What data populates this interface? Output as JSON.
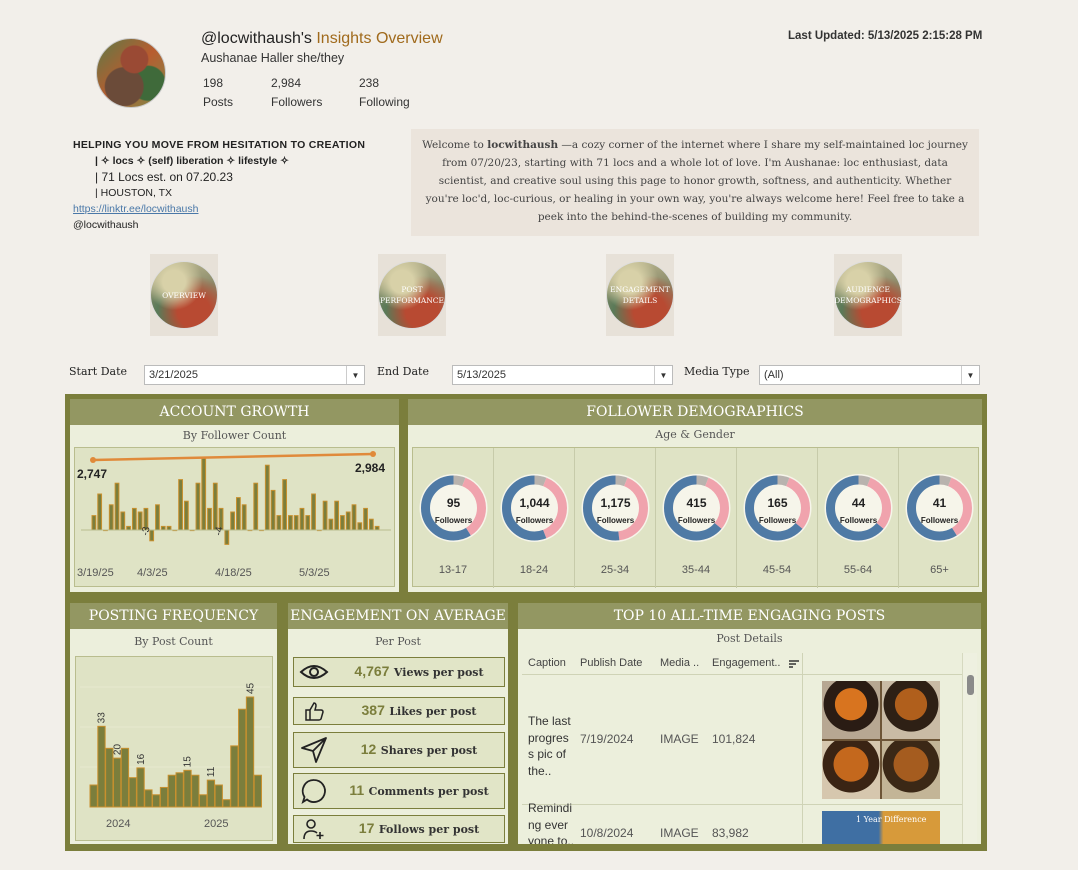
{
  "header": {
    "handle": "@locwithaush's",
    "title_accent": "Insights Overview",
    "name": "Aushanae Haller  she/they",
    "stats": [
      {
        "value": "198",
        "label": "Posts"
      },
      {
        "value": "2,984",
        "label": "Followers"
      },
      {
        "value": "238",
        "label": "Following"
      }
    ],
    "last_updated": "Last Updated: 5/13/2025 2:15:28 PM"
  },
  "bio": {
    "line1": "HELPING YOU MOVE FROM HESITATION TO CREATION",
    "line2": "| ✧ locs ✧ (self) liberation ✧ lifestyle ✧",
    "line3": "| 71 Locs est. on 07.20.23",
    "line4": "| HOUSTON, TX",
    "link": "https://linktr.ee/locwithaush",
    "line6": "@locwithaush"
  },
  "welcome": {
    "pre": "Welcome to ",
    "bold": "locwithaush",
    "text": " —a cozy corner of the internet where I share my self-maintained loc journey from 07/20/23, starting with 71 locs and a whole lot of love. I'm Aushanae: loc enthusiast, data scientist, and creative soul using this page to honor growth, softness, and authenticity. Whether you're loc'd, loc-curious, or healing in your own way, you're always welcome here! Feel free to take a peek into the behind-the-scenes of building my community."
  },
  "nav": [
    {
      "label": "OVERVIEW"
    },
    {
      "label": "POST PERFORMANCE"
    },
    {
      "label": "ENGAGEMENT DETAILS"
    },
    {
      "label": "AUDIENCE DEMOGRAPHICS"
    }
  ],
  "filters": {
    "start_label": "Start Date",
    "start_value": "3/21/2025",
    "end_label": "End Date",
    "end_value": "5/13/2025",
    "media_label": "Media Type",
    "media_value": "(All)"
  },
  "account_growth": {
    "title": "ACCOUNT GROWTH",
    "subtitle": "By Follower Count",
    "start_value": "2,747",
    "end_value": "2,984",
    "neg_labels": [
      "-3",
      "-4"
    ]
  },
  "follower_demographics": {
    "title": "FOLLOWER DEMOGRAPHICS",
    "subtitle": "Age & Gender",
    "unit": "Followers",
    "groups": [
      {
        "age": "13-17",
        "count": "95",
        "female_share": 0.35
      },
      {
        "age": "18-24",
        "count": "1,044",
        "female_share": 0.38
      },
      {
        "age": "25-34",
        "count": "1,175",
        "female_share": 0.42
      },
      {
        "age": "35-44",
        "count": "415",
        "female_share": 0.3
      },
      {
        "age": "45-54",
        "count": "165",
        "female_share": 0.3
      },
      {
        "age": "55-64",
        "count": "44",
        "female_share": 0.3
      },
      {
        "age": "65+",
        "count": "41",
        "female_share": 0.35
      }
    ],
    "colors": {
      "female": "#f0a3ad",
      "male": "#4f7aa5",
      "other": "#b8b3ae"
    }
  },
  "posting_frequency": {
    "title": "POSTING FREQUENCY",
    "subtitle": "By Post Count",
    "years": [
      "2024",
      "2025"
    ]
  },
  "engagement": {
    "title": "ENGAGEMENT ON AVERAGE",
    "subtitle": "Per Post",
    "rows": [
      {
        "icon": "eye-icon",
        "value": "4,767",
        "label": "Views per post"
      },
      {
        "icon": "thumbs-up-icon",
        "value": "387",
        "label": "Likes per post"
      },
      {
        "icon": "send-icon",
        "value": "12",
        "label": "Shares per post"
      },
      {
        "icon": "comment-icon",
        "value": "11",
        "label": "Comments per post"
      },
      {
        "icon": "add-person-icon",
        "value": "17",
        "label": "Follows per post"
      }
    ]
  },
  "top_posts": {
    "title": "TOP 10 ALL-TIME ENGAGING POSTS",
    "subtitle": "Post Details",
    "columns": [
      "Caption",
      "Publish Date",
      "Media ..",
      "Engagement.."
    ],
    "rows": [
      {
        "caption": "The last progres s pic of the..",
        "date": "7/19/2024",
        "media": "IMAGE",
        "engagement": "101,824"
      },
      {
        "caption": "Remindi ng ever yone to..",
        "date": "10/8/2024",
        "media": "IMAGE",
        "engagement": "83,982"
      }
    ],
    "thumb_text": "1 Year Difference"
  },
  "chart_data": [
    {
      "type": "bar",
      "title": "ACCOUNT GROWTH",
      "subtitle": "By Follower Count",
      "x_ticks": [
        "3/19/25",
        "4/3/25",
        "4/18/25",
        "5/3/25"
      ],
      "daily_change": [
        4,
        10,
        0,
        7,
        13,
        5,
        1,
        6,
        5,
        6,
        -3,
        7,
        1,
        1,
        0,
        14,
        8,
        0,
        13,
        20,
        6,
        13,
        6,
        -4,
        5,
        9,
        7,
        0,
        13,
        0,
        18,
        11,
        4,
        14,
        4,
        4,
        6,
        4,
        10,
        0,
        8,
        3,
        8,
        4,
        5,
        7,
        2,
        6,
        3,
        1
      ],
      "cumulative_start": 2747,
      "cumulative_end": 2984
    },
    {
      "type": "bar",
      "title": "POSTING FREQUENCY",
      "subtitle": "By Post Count",
      "values": [
        9,
        33,
        24,
        20,
        24,
        12,
        16,
        7,
        5,
        8,
        13,
        14,
        15,
        13,
        5,
        11,
        9,
        3,
        25,
        40,
        45,
        13
      ],
      "data_labels": {
        "1": "33",
        "3": "20",
        "6": "16",
        "12": "15",
        "15": "11",
        "20": "45"
      },
      "x_ticks": [
        "2024",
        "2025"
      ],
      "ylim": [
        0,
        50
      ]
    },
    {
      "type": "donut",
      "title": "FOLLOWER DEMOGRAPHICS",
      "categories": [
        "13-17",
        "18-24",
        "25-34",
        "35-44",
        "45-54",
        "55-64",
        "65+"
      ],
      "values": [
        95,
        1044,
        1175,
        415,
        165,
        44,
        41
      ]
    }
  ]
}
